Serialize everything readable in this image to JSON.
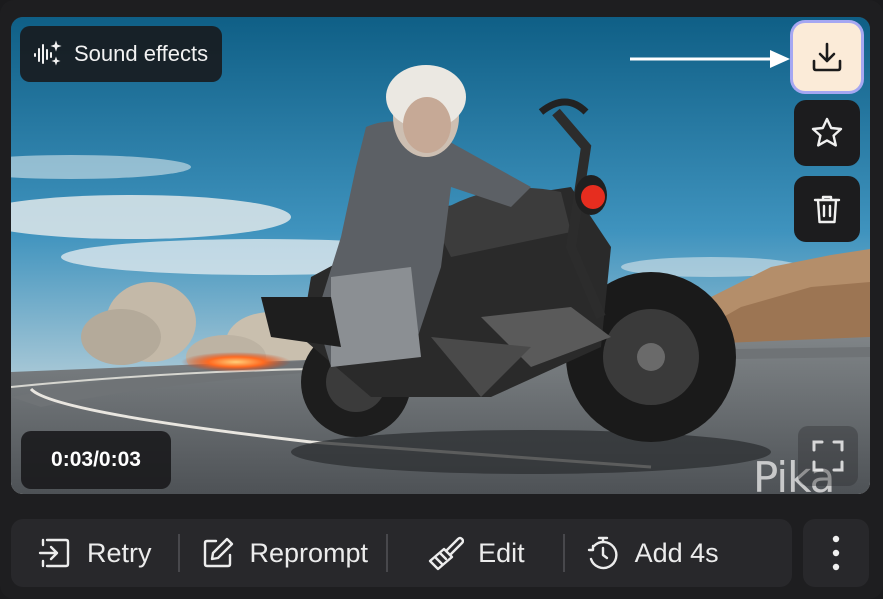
{
  "overlay": {
    "sound_effects_label": "Sound effects",
    "timecode": "0:03/0:03",
    "watermark": "Pika"
  },
  "side_actions": {
    "icons": [
      "download-icon",
      "star-icon",
      "trash-icon"
    ]
  },
  "toolbar": {
    "retry_label": "Retry",
    "reprompt_label": "Reprompt",
    "edit_label": "Edit",
    "add_label": "Add 4s"
  },
  "colors": {
    "download_bg": "#fbebd8",
    "download_ring": "#a5a7f2",
    "toolbar_bg": "#28282b",
    "card_bg": "#1e1e20"
  }
}
